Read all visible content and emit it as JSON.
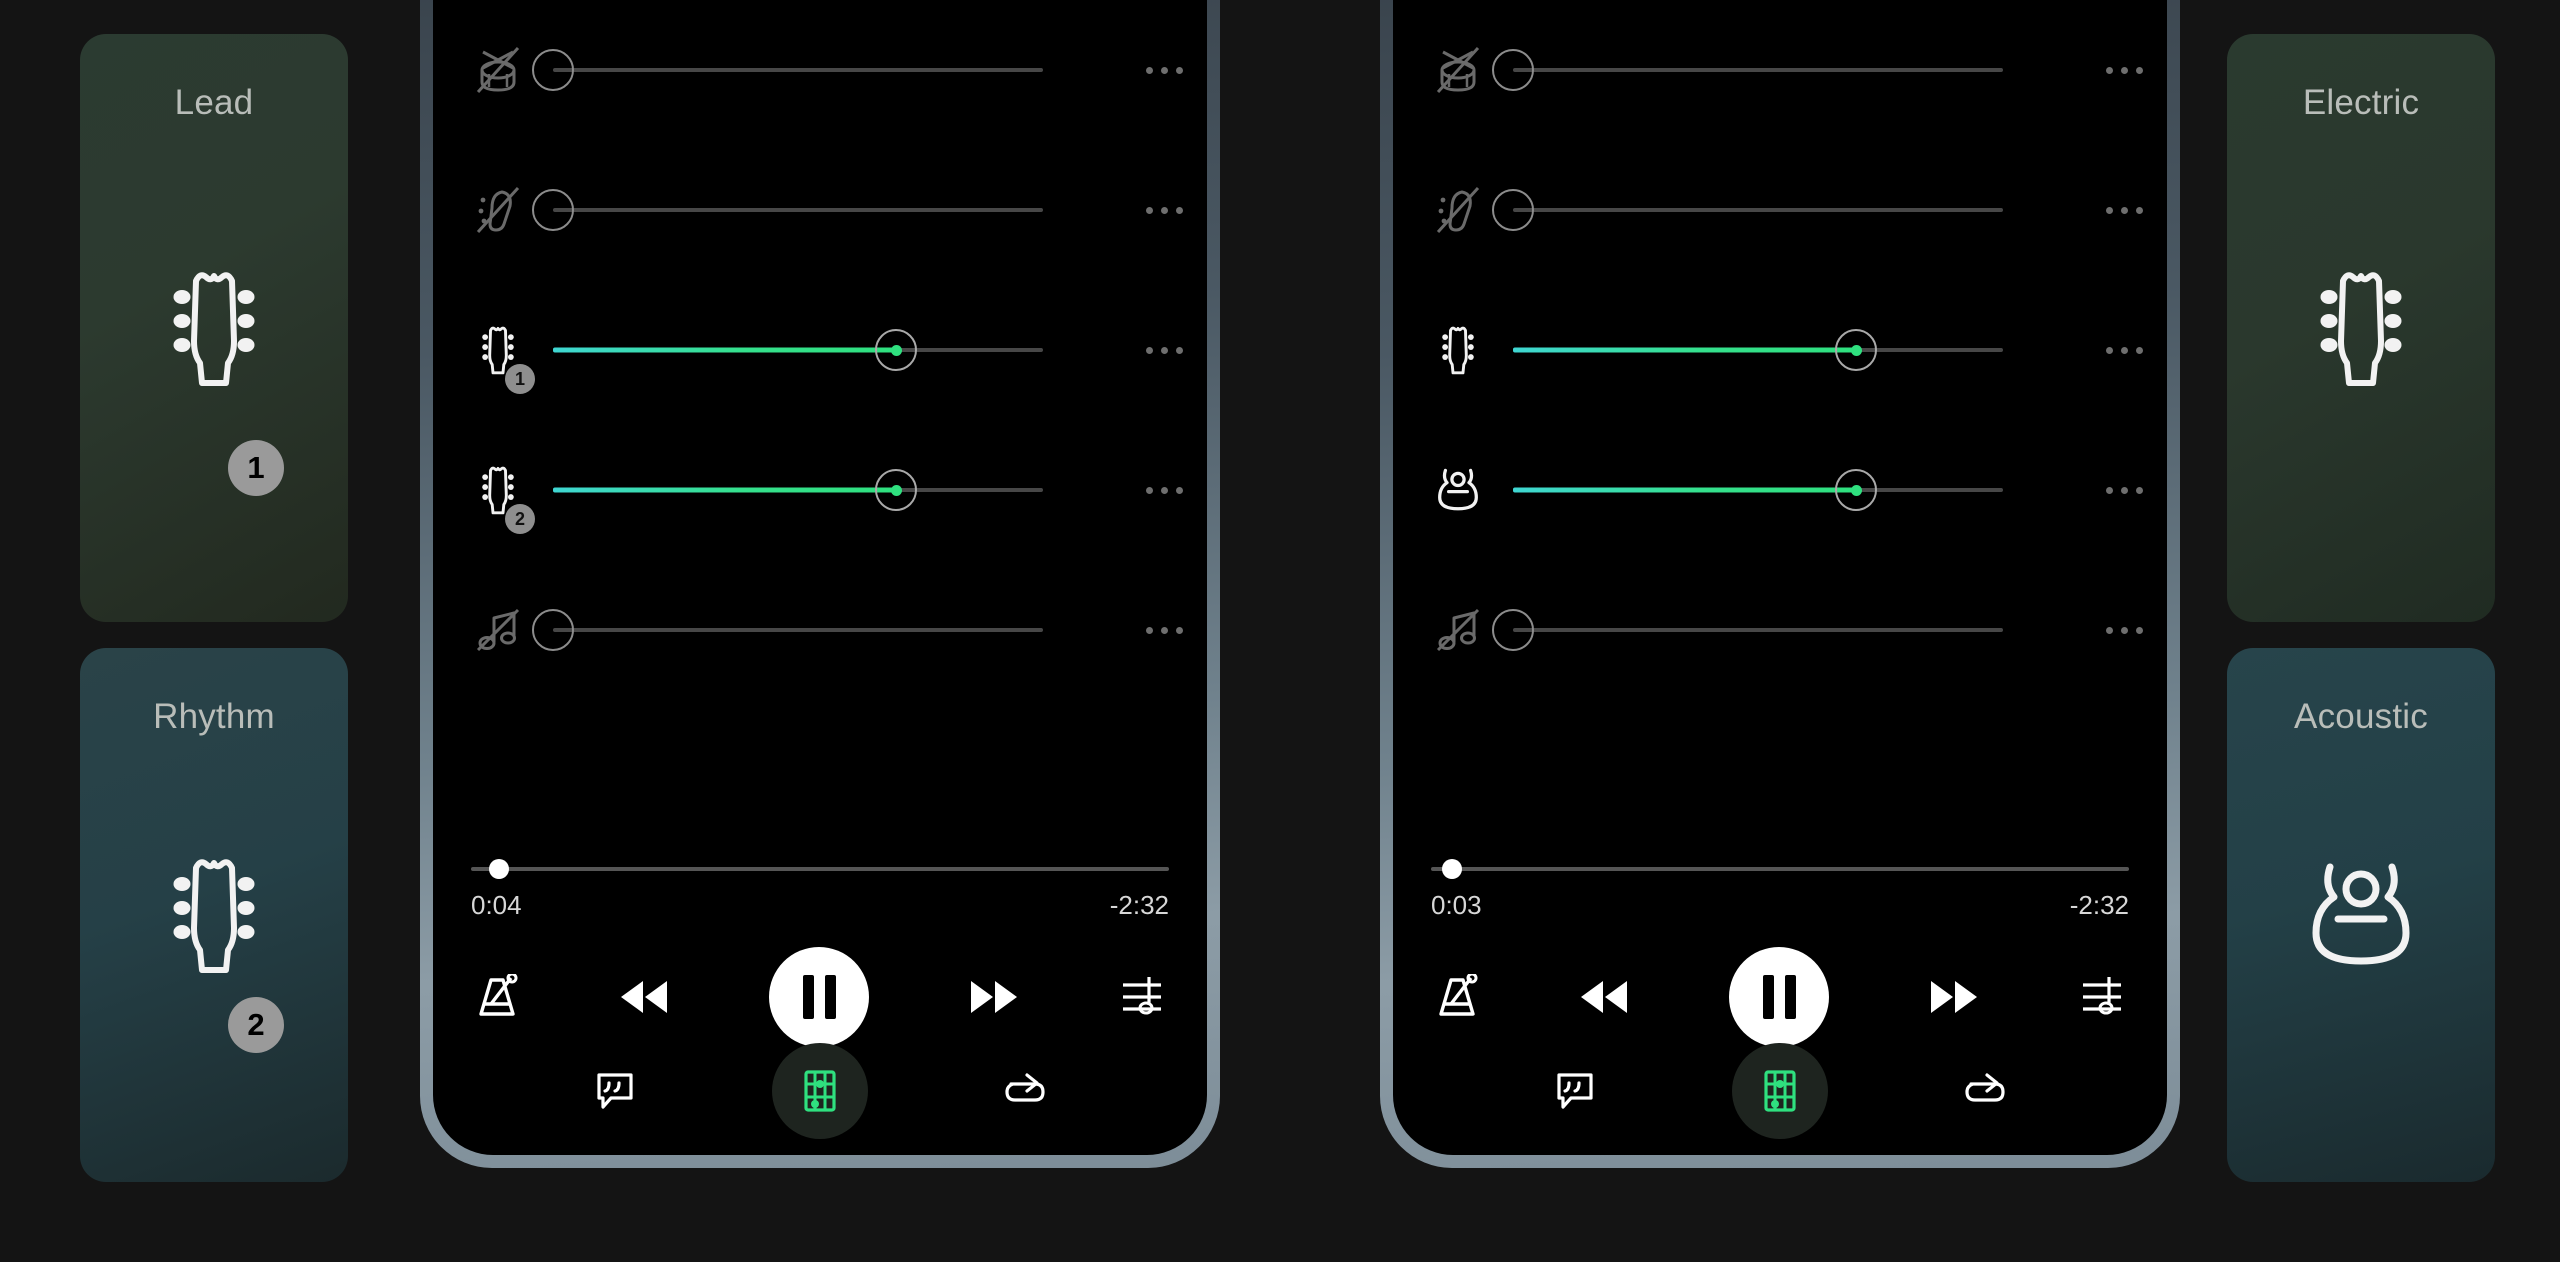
{
  "background_color": "#141414",
  "accent_green": "#2fe07f",
  "accent_cyan": "#3fd6d2",
  "left_cards": [
    {
      "title": "Lead",
      "icon": "guitar-headstock-icon",
      "badge": "1",
      "theme": "green"
    },
    {
      "title": "Rhythm",
      "icon": "guitar-headstock-icon",
      "badge": "2",
      "theme": "teal"
    }
  ],
  "right_cards": [
    {
      "title": "Electric",
      "icon": "guitar-headstock-icon",
      "badge": "",
      "theme": "green2"
    },
    {
      "title": "Acoustic",
      "icon": "acoustic-guitar-body-icon",
      "badge": "",
      "theme": "teal2"
    }
  ],
  "phones": [
    {
      "name": "phone-left",
      "mixer_rows": [
        {
          "icon": "drum-muted-icon",
          "badge": "",
          "volume": 0,
          "muted": true
        },
        {
          "icon": "shaker-muted-icon",
          "badge": "",
          "volume": 0,
          "muted": true
        },
        {
          "icon": "guitar-headstock-icon",
          "badge": "1",
          "volume": 70,
          "muted": false
        },
        {
          "icon": "guitar-headstock-icon",
          "badge": "2",
          "volume": 70,
          "muted": false
        },
        {
          "icon": "notes-muted-icon",
          "badge": "",
          "volume": 0,
          "muted": true
        }
      ],
      "row_menu_label": "more-options",
      "timeline": {
        "elapsed": "0:04",
        "remaining": "-2:32",
        "progress_percent": 4
      },
      "controls": [
        {
          "icon": "metronome-icon",
          "label": "Metronome"
        },
        {
          "icon": "rewind-icon",
          "label": "Rewind"
        },
        {
          "icon": "pause-icon",
          "label": "Pause"
        },
        {
          "icon": "fast-forward-icon",
          "label": "Fast forward"
        },
        {
          "icon": "mixer-icon",
          "label": "Mixer"
        }
      ],
      "tabs": [
        {
          "icon": "lyrics-bubble-icon",
          "label": "Lyrics",
          "active": false
        },
        {
          "icon": "chords-icon",
          "label": "Chords",
          "active": true
        },
        {
          "icon": "loop-icon",
          "label": "Loop",
          "active": false
        }
      ]
    },
    {
      "name": "phone-right",
      "mixer_rows": [
        {
          "icon": "drum-muted-icon",
          "badge": "",
          "volume": 0,
          "muted": true
        },
        {
          "icon": "shaker-muted-icon",
          "badge": "",
          "volume": 0,
          "muted": true
        },
        {
          "icon": "guitar-headstock-icon",
          "badge": "",
          "volume": 70,
          "muted": false
        },
        {
          "icon": "acoustic-guitar-body-icon",
          "badge": "",
          "volume": 70,
          "muted": false
        },
        {
          "icon": "notes-muted-icon",
          "badge": "",
          "volume": 0,
          "muted": true
        }
      ],
      "row_menu_label": "more-options",
      "timeline": {
        "elapsed": "0:03",
        "remaining": "-2:32",
        "progress_percent": 3
      },
      "controls": [
        {
          "icon": "metronome-icon",
          "label": "Metronome"
        },
        {
          "icon": "rewind-icon",
          "label": "Rewind"
        },
        {
          "icon": "pause-icon",
          "label": "Pause"
        },
        {
          "icon": "fast-forward-icon",
          "label": "Fast forward"
        },
        {
          "icon": "mixer-icon",
          "label": "Mixer"
        }
      ],
      "tabs": [
        {
          "icon": "lyrics-bubble-icon",
          "label": "Lyrics",
          "active": false
        },
        {
          "icon": "chords-icon",
          "label": "Chords",
          "active": true
        },
        {
          "icon": "loop-icon",
          "label": "Loop",
          "active": false
        }
      ]
    }
  ]
}
